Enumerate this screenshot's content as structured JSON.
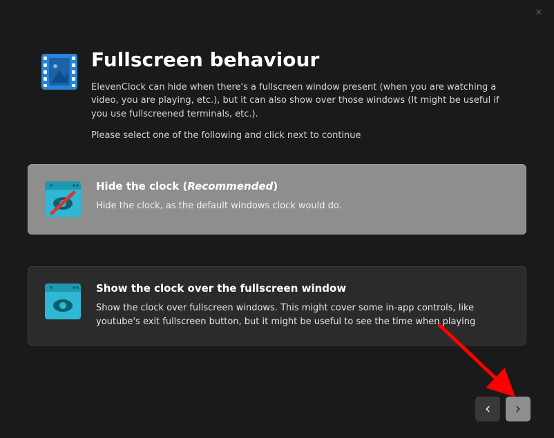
{
  "window": {
    "close_label": "✕"
  },
  "header": {
    "title": "Fullscreen behaviour",
    "description": "ElevenClock can hide when there's a fullscreen window present (when you are watching a video, you are playing, etc.), but it can also show over those windows (It might be useful if you use fullscreened terminals, etc.).",
    "instruction": "Please select one of the following and click next to continue"
  },
  "options": [
    {
      "title_prefix": "Hide the clock (",
      "recommended": "Recommended",
      "title_suffix": ")",
      "description": "Hide the clock, as the default windows clock would do.",
      "selected": true
    },
    {
      "title": "Show the clock over the fullscreen window",
      "description": "Show the clock over fullscreen windows. This might cover some in-app controls, like youtube's exit fullscreen button, but it might be useful to see the time when playing",
      "selected": false
    }
  ],
  "nav": {
    "back_label": "Back",
    "next_label": "Next"
  },
  "colors": {
    "accent": "#2585d9",
    "arrow": "#ff0000"
  }
}
